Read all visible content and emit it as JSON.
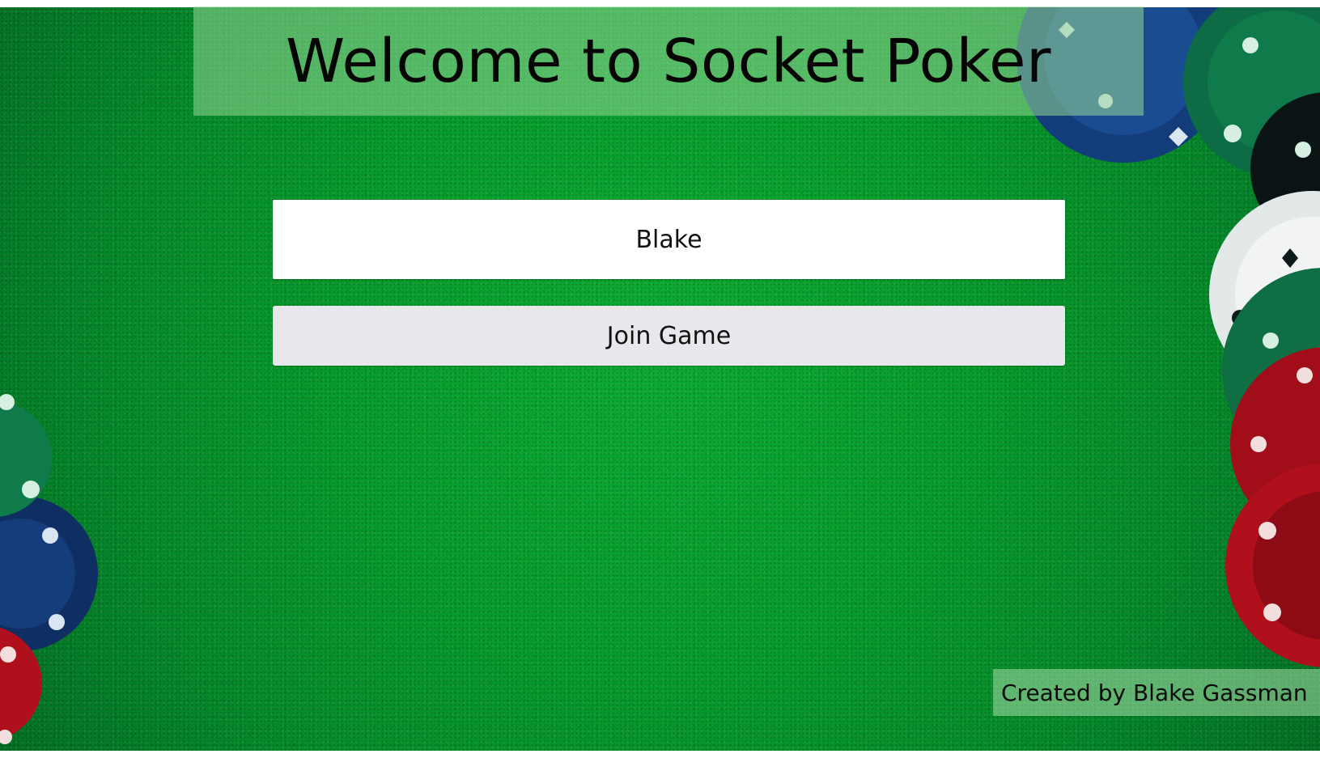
{
  "page": {
    "title": "Welcome to Socket Poker",
    "name_input_value": "Blake",
    "join_button_label": "Join Game",
    "credit": "Created by Blake Gassman"
  },
  "colors": {
    "felt": "#079c2c",
    "title_overlay": "#96d796",
    "input_bg": "#ffffff",
    "button_bg": "#e8e8ec",
    "chip_green": "#0f7a4a",
    "chip_blue": "#123d7a",
    "chip_red": "#b0101c",
    "chip_white": "#e9ecec"
  },
  "decor": {
    "chips": [
      {
        "color": "green",
        "icon": "spade-icon"
      },
      {
        "color": "blue",
        "icon": "heart-icon"
      },
      {
        "color": "red",
        "icon": "club-icon"
      },
      {
        "color": "white",
        "icon": "diamond-icon"
      }
    ]
  }
}
